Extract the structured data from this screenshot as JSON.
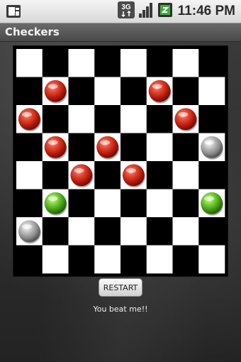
{
  "status_bar": {
    "time": "11:46 PM",
    "network_label": "3G",
    "icons": [
      "phone-notification-icon",
      "3g-data-icon",
      "signal-strength-icon",
      "battery-icon"
    ],
    "battery_color": "#3fae3a"
  },
  "app": {
    "title": "Checkers"
  },
  "board": {
    "rows": 8,
    "cols": 8,
    "dark_square_color": "#000000",
    "light_square_color": "#ffffff",
    "pieces": [
      {
        "row": 1,
        "col": 1,
        "color": "red"
      },
      {
        "row": 1,
        "col": 5,
        "color": "red"
      },
      {
        "row": 2,
        "col": 0,
        "color": "red"
      },
      {
        "row": 2,
        "col": 6,
        "color": "red"
      },
      {
        "row": 3,
        "col": 1,
        "color": "red"
      },
      {
        "row": 3,
        "col": 3,
        "color": "red"
      },
      {
        "row": 3,
        "col": 7,
        "color": "gray"
      },
      {
        "row": 4,
        "col": 2,
        "color": "red"
      },
      {
        "row": 4,
        "col": 4,
        "color": "red"
      },
      {
        "row": 5,
        "col": 1,
        "color": "green"
      },
      {
        "row": 5,
        "col": 7,
        "color": "green"
      },
      {
        "row": 6,
        "col": 0,
        "color": "gray"
      }
    ]
  },
  "controls": {
    "restart_label": "RESTART"
  },
  "message": "You beat me!!"
}
